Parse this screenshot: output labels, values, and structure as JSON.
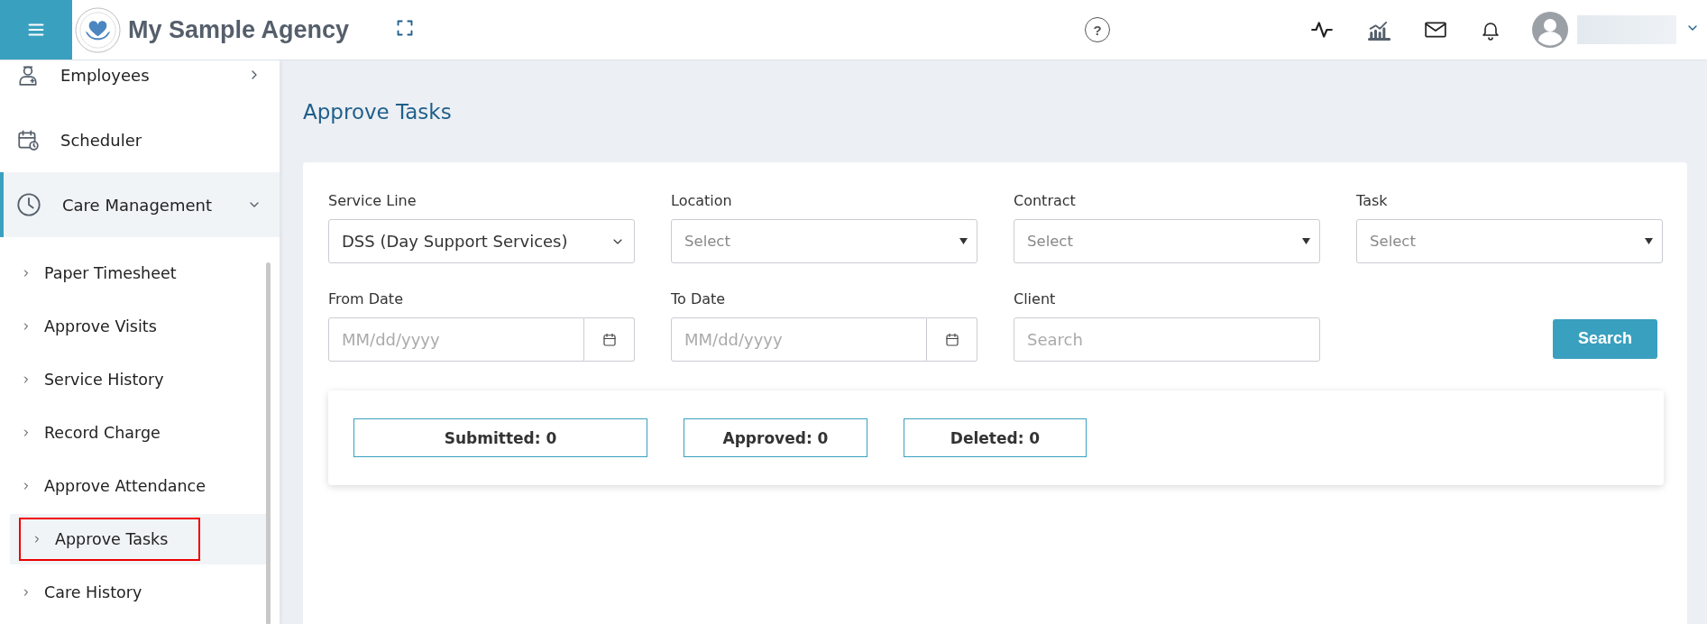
{
  "header": {
    "app_name": "My Sample Agency",
    "help": "?"
  },
  "sidebar": {
    "items": [
      {
        "label": "Employees",
        "kind": "group",
        "expanded": false
      },
      {
        "label": "Scheduler",
        "kind": "link"
      },
      {
        "label": "Care Management",
        "kind": "group",
        "expanded": true,
        "children": [
          {
            "label": "Paper Timesheet",
            "selected": false
          },
          {
            "label": "Approve Visits",
            "selected": false
          },
          {
            "label": "Service History",
            "selected": false
          },
          {
            "label": "Record Charge",
            "selected": false
          },
          {
            "label": "Approve Attendance",
            "selected": false
          },
          {
            "label": "Approve Tasks",
            "selected": true
          },
          {
            "label": "Care History",
            "selected": false
          }
        ]
      }
    ]
  },
  "page_title": "Approve Tasks",
  "filters": [
    {
      "label": "Service Line",
      "kind": "select",
      "value": "DSS (Day Support Services)"
    },
    {
      "label": "Location",
      "kind": "dropdown",
      "placeholder": "Select"
    },
    {
      "label": "Contract",
      "kind": "dropdown",
      "placeholder": "Select"
    },
    {
      "label": "Task",
      "kind": "dropdown",
      "placeholder": "Select"
    },
    {
      "label": "From Date",
      "kind": "date",
      "placeholder": "MM/dd/yyyy"
    },
    {
      "label": "To Date",
      "kind": "date",
      "placeholder": "MM/dd/yyyy"
    },
    {
      "label": "Client",
      "kind": "text",
      "placeholder": "Search"
    }
  ],
  "search_button": "Search",
  "counts": [
    "Submitted: 0",
    "Approved: 0",
    "Deleted: 0"
  ]
}
